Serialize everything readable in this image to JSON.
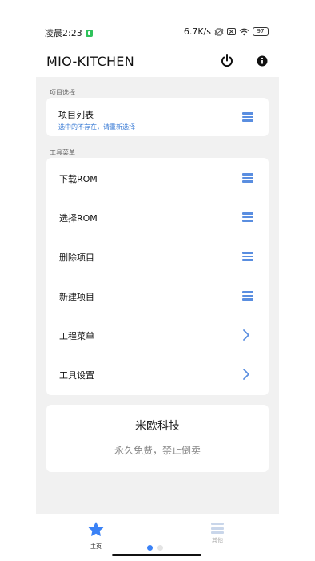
{
  "status_bar": {
    "time": "凌晨2:23",
    "speed": "6.7K/s",
    "battery": "97"
  },
  "app_bar": {
    "title": "MIO-KITCHEN",
    "power_icon": "power-icon",
    "info_icon": "info-icon"
  },
  "project_section": {
    "label": "项目选择",
    "card_title": "项目列表",
    "card_subtitle": "选中的不存在，请重新选择"
  },
  "tools_section": {
    "label": "工具菜单",
    "items": [
      {
        "label": "下载ROM",
        "icon": "menu-icon"
      },
      {
        "label": "选择ROM",
        "icon": "menu-icon"
      },
      {
        "label": "删除项目",
        "icon": "menu-icon"
      },
      {
        "label": "新建项目",
        "icon": "menu-icon"
      },
      {
        "label": "工程菜单",
        "icon": "chevron-right-icon"
      },
      {
        "label": "工具设置",
        "icon": "chevron-right-icon"
      }
    ]
  },
  "brand": {
    "title": "米欧科技",
    "subtitle": "永久免费，禁止倒卖"
  },
  "bottom_nav": {
    "items": [
      {
        "label": "主页",
        "icon": "star-icon",
        "active": true
      },
      {
        "label": "其他",
        "icon": "menu-icon",
        "active": false
      }
    ]
  },
  "colors": {
    "accent": "#5a8ee0",
    "active_nav": "#3b82f6",
    "content_bg": "#f1f1f1"
  }
}
